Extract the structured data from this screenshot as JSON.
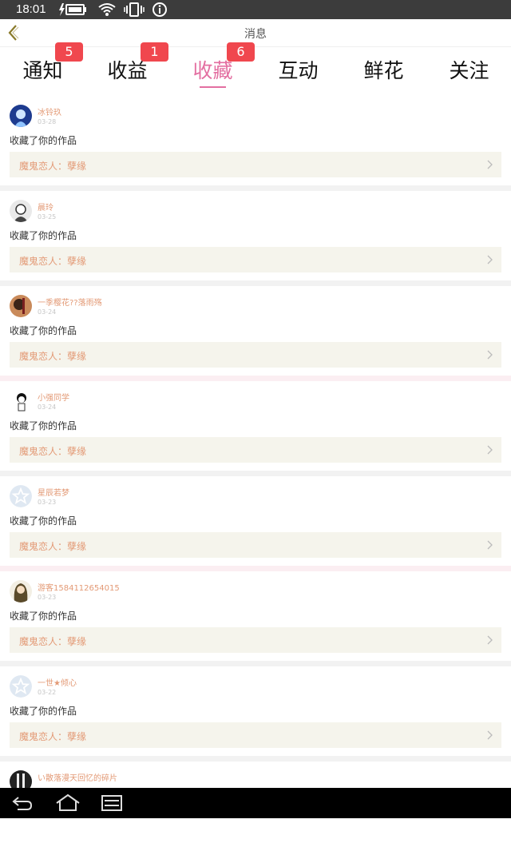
{
  "status_bar": {
    "time": "18:01"
  },
  "header": {
    "title": "消息"
  },
  "tabs": [
    {
      "label": "通知",
      "badge": "5"
    },
    {
      "label": "收益",
      "badge": "1"
    },
    {
      "label": "收藏",
      "badge": "6",
      "active": true
    },
    {
      "label": "互动"
    },
    {
      "label": "鲜花"
    },
    {
      "label": "关注"
    }
  ],
  "messages": [
    {
      "user": "冰铃玖",
      "date": "03-28",
      "action": "收藏了你的作品",
      "work": "魔鬼恋人：孽缘"
    },
    {
      "user": "晨玲",
      "date": "03-25",
      "action": "收藏了你的作品",
      "work": "魔鬼恋人：孽缘"
    },
    {
      "user": "一季樱花??落雨殇",
      "date": "03-24",
      "action": "收藏了你的作品",
      "work": "魔鬼恋人：孽缘"
    },
    {
      "user": "小强同学",
      "date": "03-24",
      "action": "收藏了你的作品",
      "work": "魔鬼恋人：孽缘"
    },
    {
      "user": "星辰若梦",
      "date": "03-23",
      "action": "收藏了你的作品",
      "work": "魔鬼恋人：孽缘"
    },
    {
      "user": "游客1584112654015",
      "date": "03-23",
      "action": "收藏了你的作品",
      "work": "魔鬼恋人：孽缘"
    },
    {
      "user": "一世★倾心",
      "date": "03-22",
      "action": "收藏了你的作品",
      "work": "魔鬼恋人：孽缘"
    },
    {
      "user": "い散落漫天回忆的碎片",
      "date": "",
      "action": "",
      "work": ""
    }
  ],
  "colors": {
    "accent": "#e36fa1",
    "badge": "#f0474e",
    "username": "#e39a76",
    "card_bg": "#f5f4ec"
  }
}
